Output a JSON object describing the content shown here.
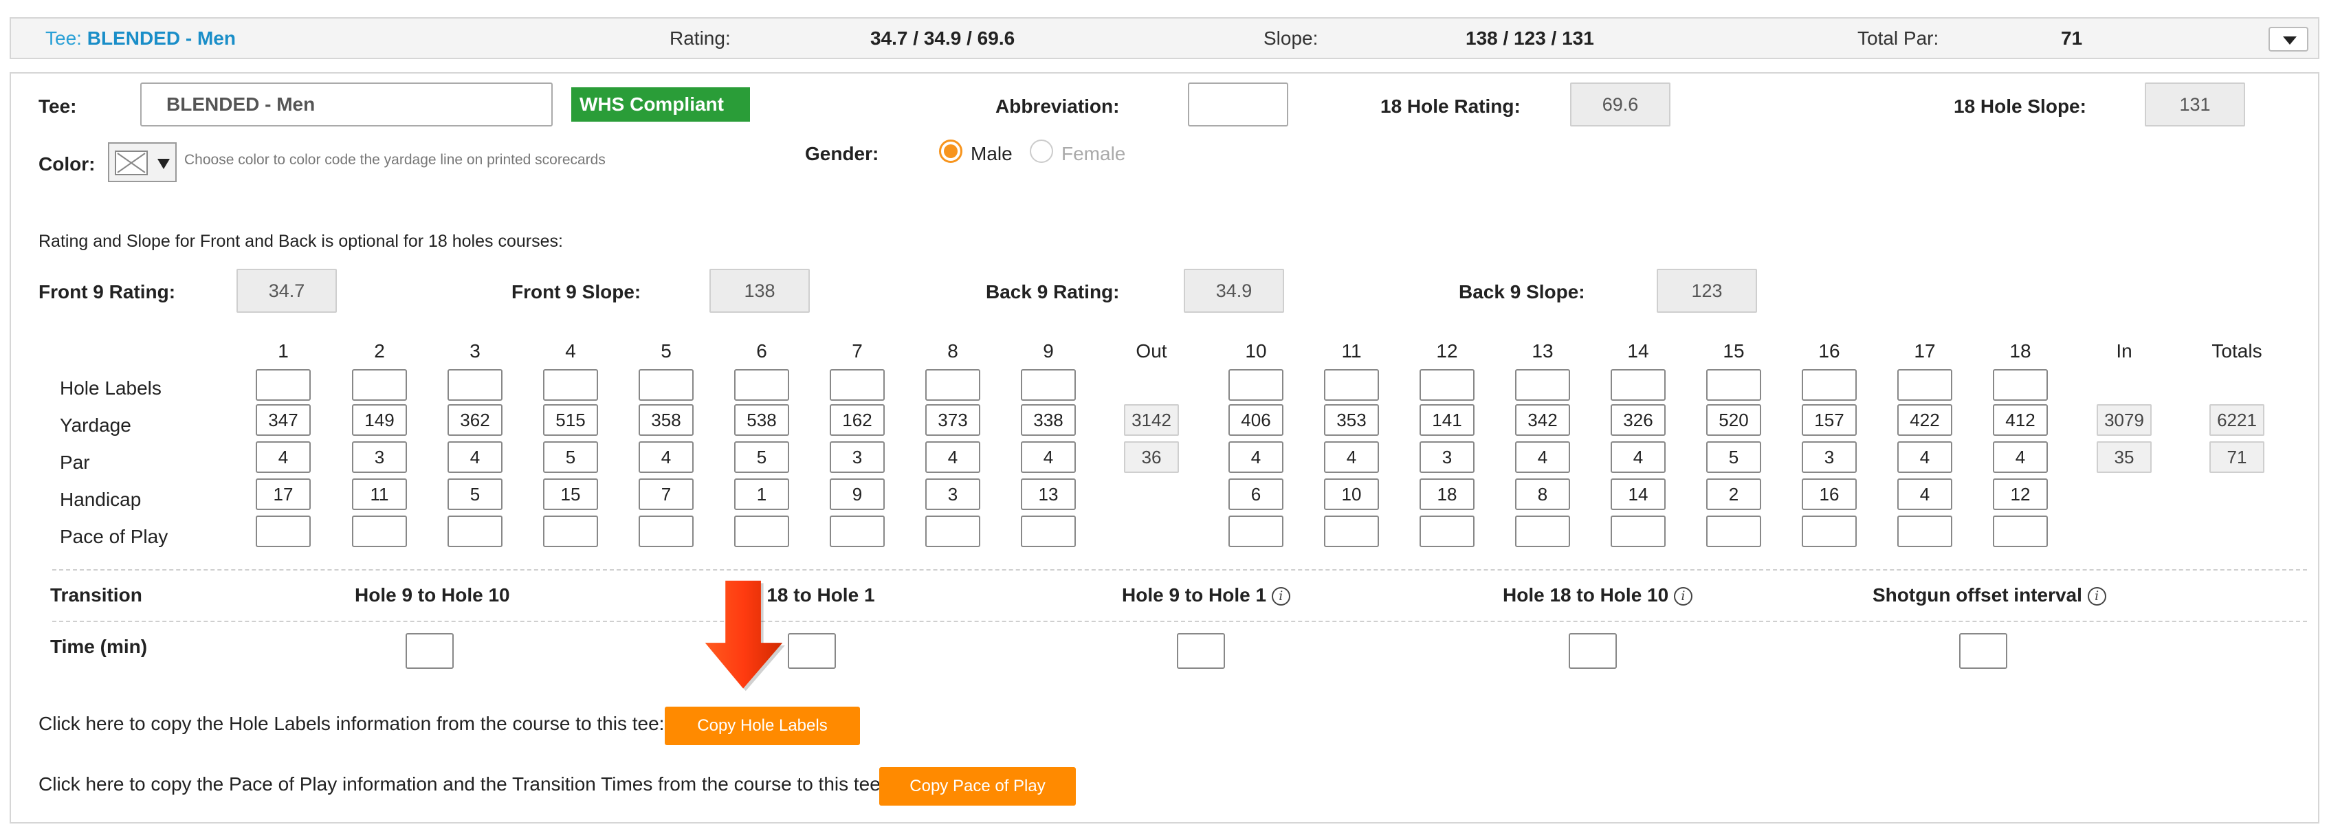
{
  "summary": {
    "tee_label": "Tee:",
    "tee_value": "BLENDED - Men",
    "rating_label": "Rating:",
    "rating_value": "34.7 / 34.9 / 69.6",
    "slope_label": "Slope:",
    "slope_value": "138 / 123 / 131",
    "par_label": "Total Par:",
    "par_value": "71"
  },
  "form": {
    "tee_label": "Tee:",
    "tee_value": "BLENDED - Men",
    "whs_badge": "WHS Compliant",
    "abbreviation_label": "Abbreviation:",
    "abbreviation_value": "",
    "rating18_label": "18 Hole Rating:",
    "rating18_value": "69.6",
    "slope18_label": "18 Hole Slope:",
    "slope18_value": "131",
    "color_label": "Color:",
    "color_hint": "Choose color to color code the yardage line on printed scorecards",
    "gender_label": "Gender:",
    "gender_male": "Male",
    "gender_female": "Female",
    "gender_selected": "Male",
    "optional_note": "Rating and Slope for Front and Back is optional for 18 holes courses:",
    "front_rating_label": "Front 9 Rating:",
    "front_rating_value": "34.7",
    "front_slope_label": "Front 9 Slope:",
    "front_slope_value": "138",
    "back_rating_label": "Back 9 Rating:",
    "back_rating_value": "34.9",
    "back_slope_label": "Back 9 Slope:",
    "back_slope_value": "123"
  },
  "grid": {
    "hole_headers": [
      "1",
      "2",
      "3",
      "4",
      "5",
      "6",
      "7",
      "8",
      "9",
      "Out",
      "10",
      "11",
      "12",
      "13",
      "14",
      "15",
      "16",
      "17",
      "18",
      "In",
      "Totals"
    ],
    "row_labels": [
      "Hole Labels",
      "Yardage",
      "Par",
      "Handicap",
      "Pace of Play"
    ],
    "yardage": [
      "347",
      "149",
      "362",
      "515",
      "358",
      "538",
      "162",
      "373",
      "338",
      "406",
      "353",
      "141",
      "342",
      "326",
      "520",
      "157",
      "422",
      "412"
    ],
    "par": [
      "4",
      "3",
      "4",
      "5",
      "4",
      "5",
      "3",
      "4",
      "4",
      "4",
      "4",
      "3",
      "4",
      "4",
      "5",
      "3",
      "4",
      "4"
    ],
    "handicap": [
      "17",
      "11",
      "5",
      "15",
      "7",
      "1",
      "9",
      "3",
      "13",
      "6",
      "10",
      "18",
      "8",
      "14",
      "2",
      "16",
      "4",
      "12"
    ],
    "out_yardage": "3142",
    "out_par": "36",
    "in_yardage": "3079",
    "in_par": "35",
    "total_yardage": "6221",
    "total_par": "71"
  },
  "transition": {
    "label": "Transition",
    "time_label": "Time (min)",
    "headers": [
      "Hole 9 to Hole 10",
      "e 18 to Hole 1",
      "Hole 9 to Hole 1",
      "Hole 18 to Hole 10",
      "Shotgun offset interval"
    ]
  },
  "copy": {
    "labels_text": "Click here to copy the Hole Labels information from the course to this tee:",
    "labels_button": "Copy Hole Labels",
    "pace_text": "Click here to copy the Pace of Play information and the Transition Times from the course to this tee:",
    "pace_button": "Copy Pace of Play"
  },
  "colors": {
    "accent_orange": "#ff8a00",
    "whs_green": "#2a9d38",
    "tee_blue": "#1a8ec8"
  }
}
